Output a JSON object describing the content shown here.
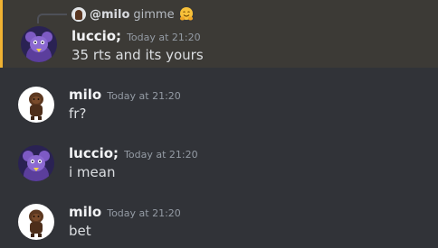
{
  "colors": {
    "background": "#313338",
    "highlight_bg": "#3c3a36",
    "mention_bar": "#f0b232",
    "username": "#f2f3f5",
    "timestamp": "#949ba4",
    "message_text": "#dbdee1"
  },
  "messages": [
    {
      "author": "luccio;",
      "timestamp": "Today at 21:20",
      "text": "35 rts and its yours",
      "avatar_icon": "purple-character-avatar",
      "highlighted": true,
      "reply": {
        "author": "@milo",
        "text": "gimme",
        "emoji": "hugging-face-emoji",
        "avatar_icon": "brown-character-avatar"
      }
    },
    {
      "author": "milo",
      "timestamp": "Today at 21:20",
      "text": "fr?",
      "avatar_icon": "brown-character-avatar"
    },
    {
      "author": "luccio;",
      "timestamp": "Today at 21:20",
      "text": "i mean",
      "avatar_icon": "purple-character-avatar"
    },
    {
      "author": "milo",
      "timestamp": "Today at 21:20",
      "text": "bet",
      "avatar_icon": "brown-character-avatar"
    }
  ]
}
